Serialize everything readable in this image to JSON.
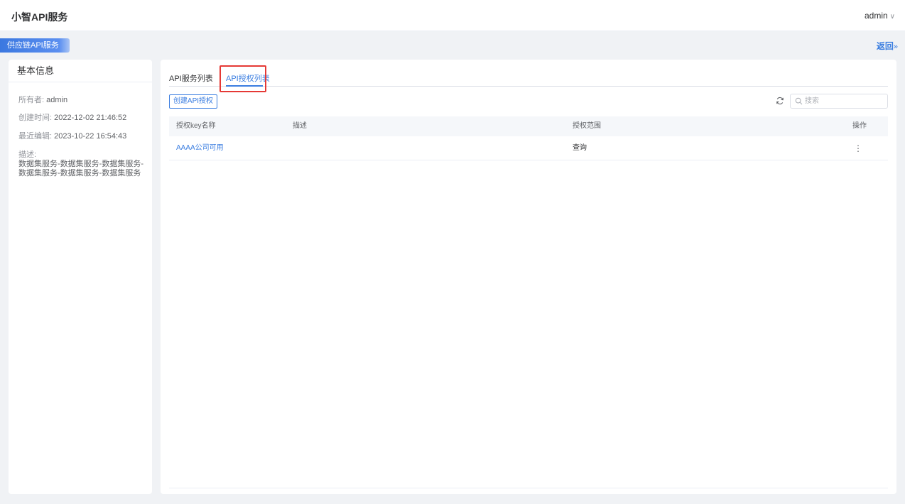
{
  "app": {
    "title": "小智API服务",
    "user": "admin"
  },
  "subheader": {
    "service_tag": "供应链API服务",
    "back": "返回",
    "back_arrow": "»"
  },
  "info": {
    "title": "基本信息",
    "owner_label": "所有者:",
    "owner": "admin",
    "created_label": "创建时间:",
    "created": "2022-12-02 21:46:52",
    "edited_label": "最近编辑:",
    "edited": "2023-10-22 16:54:43",
    "desc_label": "描述:",
    "desc_line1": "数据集服务-数据集服务-数据集服务-",
    "desc_line2": "数据集服务-数据集服务-数据集服务"
  },
  "tabs": [
    {
      "label": "API服务列表",
      "active": false
    },
    {
      "label": "API授权列表",
      "active": true
    }
  ],
  "toolbar": {
    "create_label": "创建API授权",
    "search_placeholder": "搜索"
  },
  "table": {
    "headers": [
      "授权key名称",
      "描述",
      "授权范围",
      "操作"
    ],
    "rows": [
      {
        "name": "AAAA公司可用",
        "desc": "",
        "scope": "查询",
        "action": "⋮"
      }
    ]
  },
  "colors": {
    "accent": "#3a7de0",
    "highlight": "#e53935"
  },
  "icons": {
    "refresh": "refresh-icon",
    "search": "search-icon",
    "chevron": "chevron-down-icon",
    "more": "more-vertical-icon"
  }
}
